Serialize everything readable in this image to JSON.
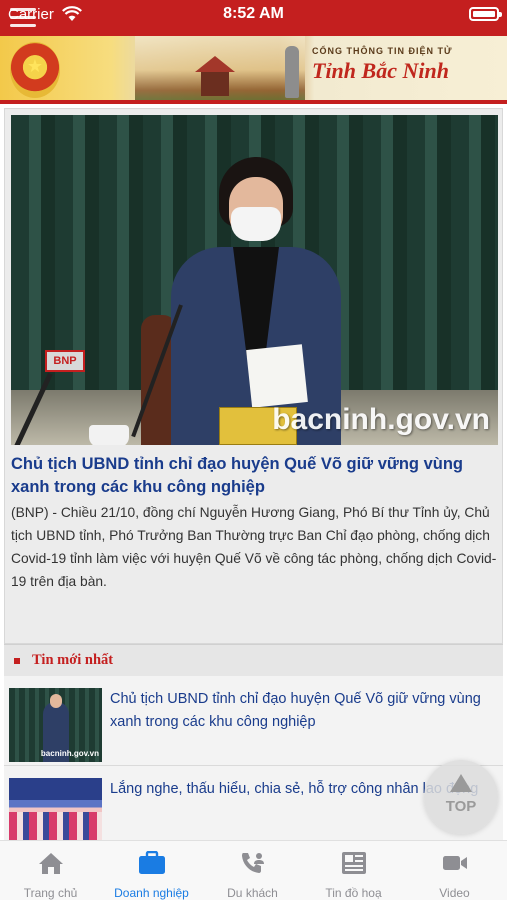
{
  "status_bar": {
    "carrier": "Carrier",
    "time": "8:52 AM"
  },
  "banner": {
    "subtitle": "CỔNG THÔNG TIN ĐIỆN TỬ",
    "title": "Tỉnh Bắc Ninh"
  },
  "featured": {
    "watermark": "bacninh.gov.vn",
    "title": "Chủ tịch UBND tỉnh chỉ đạo huyện Quế Võ giữ vững vùng xanh trong các khu công nghiệp",
    "description": "(BNP) - Chiều 21/10, đồng chí Nguyễn Hương Giang, Phó Bí thư Tỉnh ủy, Chủ tịch UBND tỉnh, Phó Trưởng Ban Thường trực Ban Chỉ đạo phòng, chống dịch Covid-19 tỉnh làm việc với huyện Quế Võ về công tác phòng, chống dịch Covid-19 trên địa bàn."
  },
  "latest": {
    "heading": "Tin mới nhất",
    "items": [
      {
        "title": "Chủ tịch UBND tỉnh chỉ đạo huyện Quế Võ giữ vững vùng xanh trong các khu công nghiệp",
        "thumb_watermark": "bacninh.gov.vn"
      },
      {
        "title": "Lắng nghe, thấu hiểu, chia sẻ, hỗ trợ công nhân lao động"
      }
    ]
  },
  "top_button": {
    "label": "TOP"
  },
  "tabs": [
    {
      "label": "Trang chủ",
      "icon": "home-icon"
    },
    {
      "label": "Doanh nghiệp",
      "icon": "briefcase-icon",
      "active": true
    },
    {
      "label": "Du khách",
      "icon": "phone-person-icon"
    },
    {
      "label": "Tin đồ hoạ",
      "icon": "newspaper-icon"
    },
    {
      "label": "Video",
      "icon": "video-camera-icon"
    }
  ],
  "colors": {
    "header_red": "#c41f1f",
    "link_blue": "#1a3c8c",
    "tab_active": "#1a7ce3",
    "tab_inactive": "#8e8e93"
  }
}
